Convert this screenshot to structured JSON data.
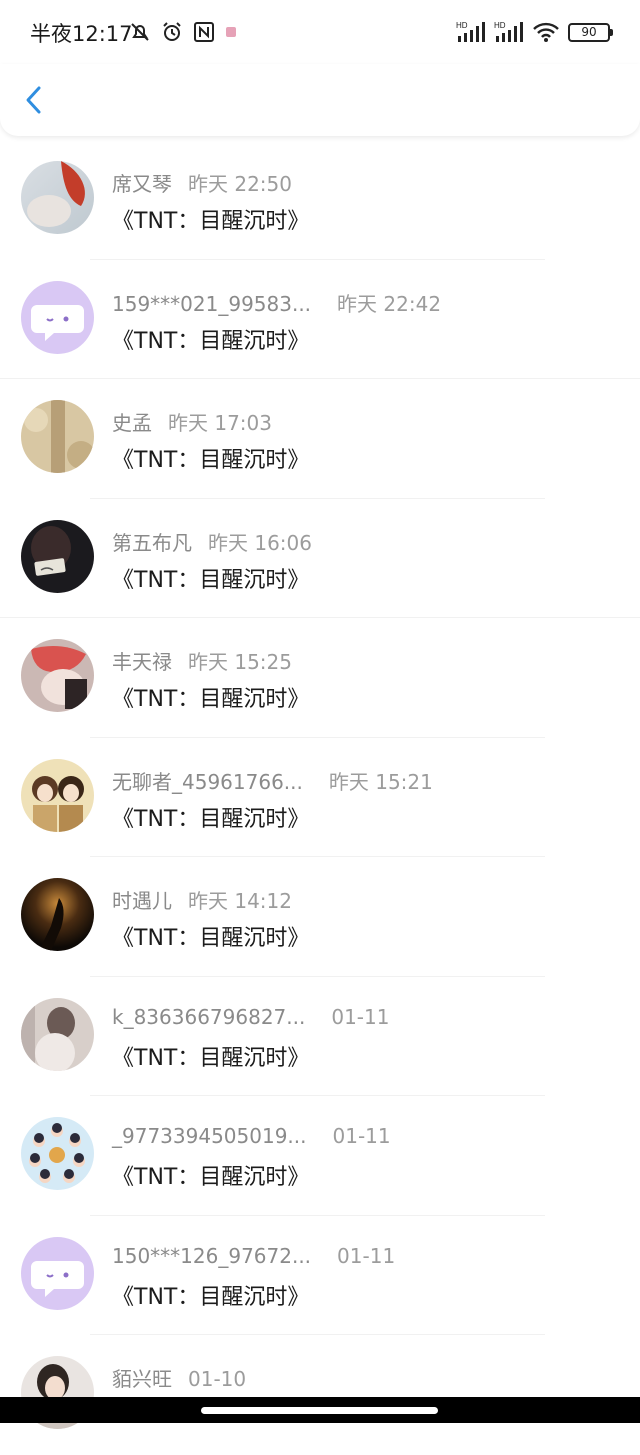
{
  "status_bar": {
    "time": "半夜12:17",
    "battery": "90"
  },
  "header": {
    "back_icon": "chevron-left-icon",
    "accent": "#2f8ee0"
  },
  "rows": [
    {
      "name": "席又琴",
      "time": "昨天 22:50",
      "message": "《TNT：目醒沉时》",
      "avatar": "photo"
    },
    {
      "name": "159***021_99583...",
      "time": "昨天 22:42",
      "message": "《TNT：目醒沉时》",
      "avatar": "default-chat"
    },
    {
      "name": "史孟",
      "time": "昨天 17:03",
      "message": "《TNT：目醒沉时》",
      "avatar": "photo"
    },
    {
      "name": "第五布凡",
      "time": "昨天 16:06",
      "message": "《TNT：目醒沉时》",
      "avatar": "photo"
    },
    {
      "name": "丰天禄",
      "time": "昨天 15:25",
      "message": "《TNT：目醒沉时》",
      "avatar": "photo"
    },
    {
      "name": "无聊者_45961766...",
      "time": "昨天 15:21",
      "message": "《TNT：目醒沉时》",
      "avatar": "photo"
    },
    {
      "name": "时遇儿",
      "time": "昨天 14:12",
      "message": "《TNT：目醒沉时》",
      "avatar": "photo"
    },
    {
      "name": "k_836366796827...",
      "time": "01-11",
      "message": "《TNT：目醒沉时》",
      "avatar": "photo"
    },
    {
      "name": "_9773394505019...",
      "time": "01-11",
      "message": "《TNT：目醒沉时》",
      "avatar": "photo"
    },
    {
      "name": "150***126_97672...",
      "time": "01-11",
      "message": "《TNT：目醒沉时》",
      "avatar": "default-chat"
    },
    {
      "name": "貊兴旺",
      "time": "01-10",
      "message": "",
      "avatar": "photo"
    }
  ]
}
